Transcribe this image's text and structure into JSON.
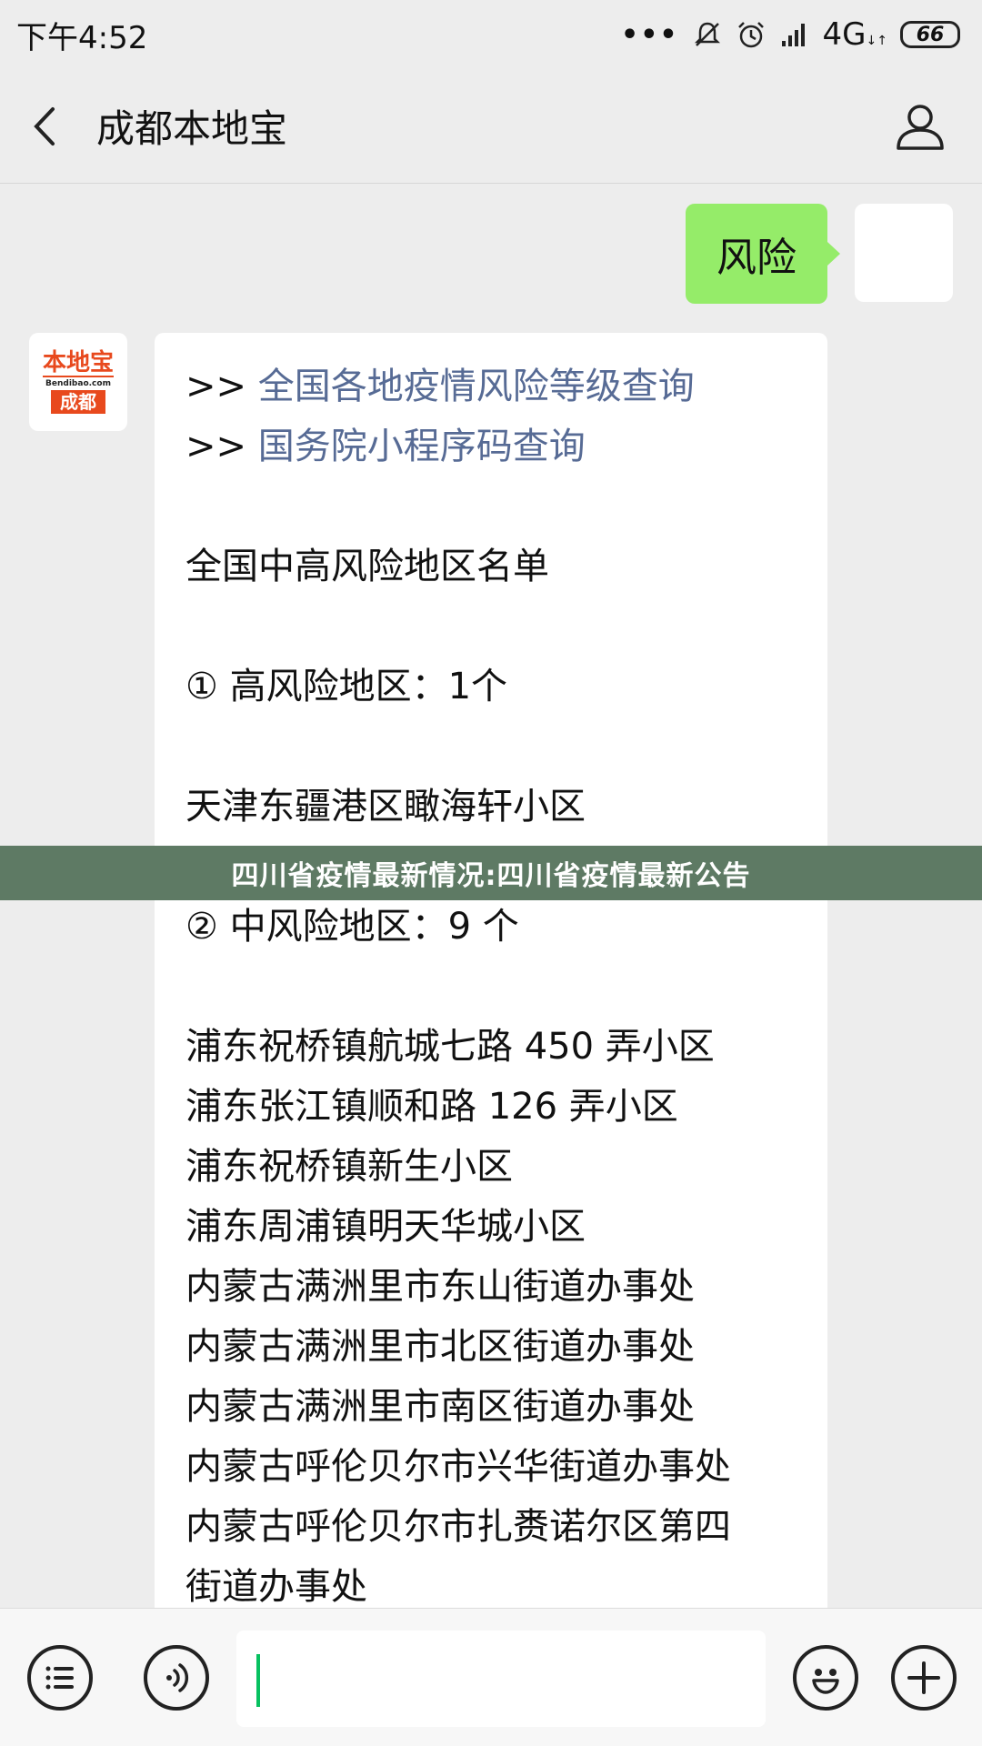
{
  "status_bar": {
    "time": "下午4:52",
    "dots": "•••",
    "network": "4G",
    "network_sub": "↓↑",
    "battery": "66"
  },
  "header": {
    "title": "成都本地宝"
  },
  "messages": {
    "sent_text": "风险",
    "bot_avatar": {
      "logo_top": "本地宝",
      "logo_mid": "Bendibao.com",
      "logo_bottom": "成都"
    },
    "reply": {
      "arrow": ">>",
      "link1": "全国各地疫情风险等级查询",
      "link2": "国务院小程序码查询",
      "heading": "全国中高风险地区名单",
      "high_risk": "① 高风险地区：1个",
      "high_list": [
        "天津东疆港区瞰海轩小区"
      ],
      "mid_risk": "② 中风险地区：9 个",
      "mid_list": [
        "浦东祝桥镇航城七路 450 弄小区",
        "浦东张江镇顺和路 126 弄小区",
        "浦东祝桥镇新生小区",
        "浦东周浦镇明天华城小区",
        "内蒙古满洲里市东山街道办事处",
        "内蒙古满洲里市北区街道办事处",
        "内蒙古满洲里市南区街道办事处",
        "内蒙古呼伦贝尔市兴华街道办事处",
        "内蒙古呼伦贝尔市扎赉诺尔区第四",
        "街道办事处"
      ]
    }
  },
  "banner": {
    "text": "四川省疫情最新情况:四川省疫情最新公告"
  },
  "colors": {
    "background": "#ededed",
    "sent_bubble": "#95ec69",
    "link": "#576b95",
    "banner": "#5e7a64",
    "caret": "#07c160",
    "brand": "#e8491d"
  },
  "icons": {
    "back": "chevron-left-icon",
    "profile": "person-icon",
    "menu": "list-menu-icon",
    "voice": "voice-icon",
    "emoji": "smiley-icon",
    "plus": "plus-icon"
  }
}
